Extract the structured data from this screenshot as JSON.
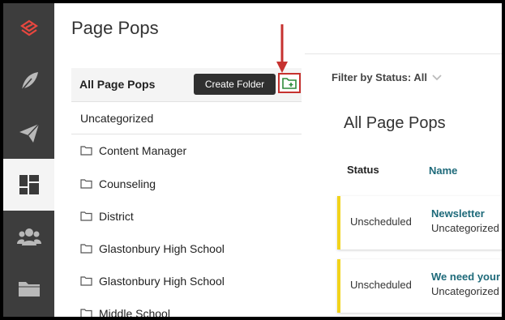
{
  "page": {
    "title": "Page Pops"
  },
  "sidebar": {
    "items": [
      {
        "icon": "logo-icon"
      },
      {
        "icon": "feather-icon"
      },
      {
        "icon": "paper-plane-icon"
      },
      {
        "icon": "dashboard-icon",
        "active": true
      },
      {
        "icon": "users-icon"
      },
      {
        "icon": "folder-icon"
      }
    ]
  },
  "folders": {
    "header_label": "All Page Pops",
    "create_button": "Create Folder",
    "uncategorized": "Uncategorized",
    "items": [
      "Content Manager",
      "Counseling",
      "District",
      "Glastonbury High School",
      "Glastonbury High School",
      "Middle School"
    ]
  },
  "filter": {
    "label": "Filter by Status: All"
  },
  "content": {
    "title": "All Page Pops",
    "columns": {
      "status": "Status",
      "name": "Name"
    },
    "rows": [
      {
        "status": "Unscheduled",
        "name": "Newsletter",
        "folder": "Uncategorized"
      },
      {
        "status": "Unscheduled",
        "name": "We need your h",
        "folder": "Uncategorized"
      }
    ]
  },
  "colors": {
    "accent": "#1e6a7a",
    "highlight": "#c6322f",
    "status_unscheduled": "#f2d31b",
    "sidebar": "#3d3d3d"
  }
}
